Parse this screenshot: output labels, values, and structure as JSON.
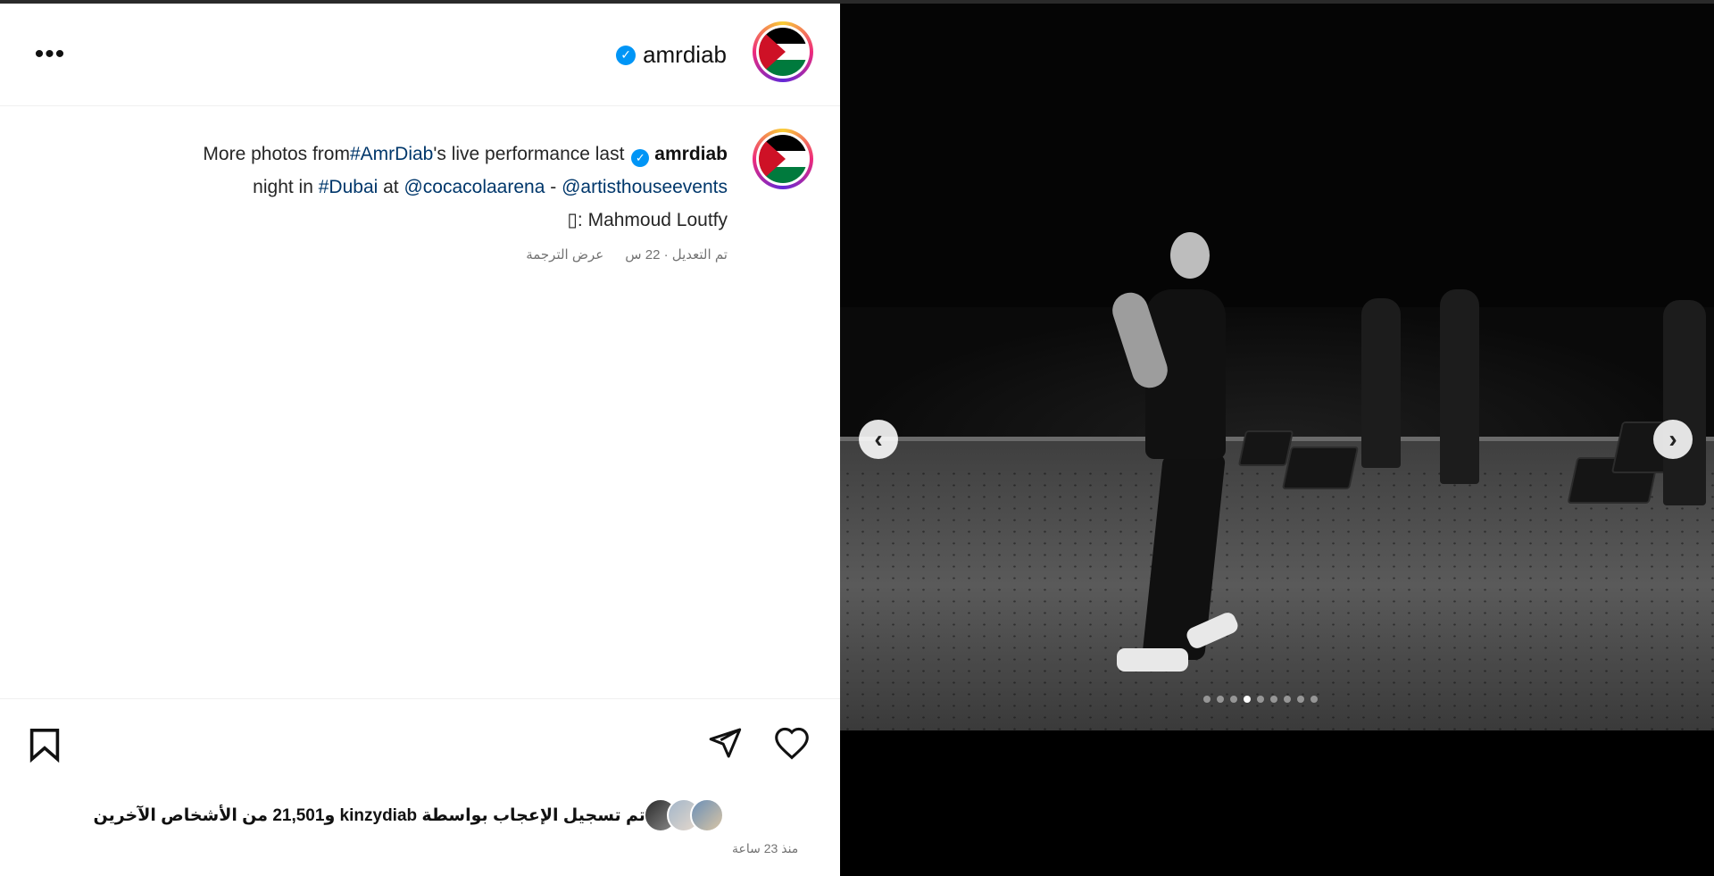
{
  "header": {
    "username": "amrdiab",
    "more_label": "•••"
  },
  "caption": {
    "username": "amrdiab",
    "text_1": "More photos from",
    "hashtag_1": "#AmrDiab",
    "text_2": "'s live performance last",
    "text_3": "night in ",
    "hashtag_2": "#Dubai",
    "text_4": " at ",
    "mention_1": "@cocacolaarena",
    "text_5": " - ",
    "mention_2": "@artisthouseevents",
    "credit_symbol": "▯",
    "credit": ": Mahmoud Loutfy",
    "edited_time": "تم التعديل · 22 س",
    "see_translation": "عرض الترجمة"
  },
  "likes": {
    "text": "تم تسجيل الإعجاب بواسطة kinzydiab و21,501 من الأشخاص الآخرين",
    "timestamp": "منذ 23 ساعة"
  },
  "carousel": {
    "prev_label": "‹",
    "next_label": "›",
    "total_dots": 9,
    "active_dot": 4
  },
  "colors": {
    "verified": "#0095f6",
    "link": "#00376b",
    "muted": "#737373"
  }
}
